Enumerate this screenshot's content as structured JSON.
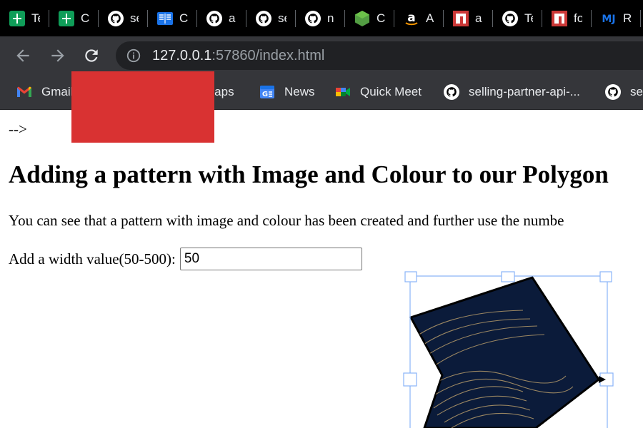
{
  "browser": {
    "tabs": [
      {
        "icon": "google-sheets-icon",
        "label": "Te",
        "color": "#0f9d58"
      },
      {
        "icon": "google-sheets-icon",
        "label": "C",
        "color": "#0f9d58"
      },
      {
        "icon": "github-icon",
        "label": "se"
      },
      {
        "icon": "book-icon",
        "label": "C",
        "color": "#1a73e8"
      },
      {
        "icon": "github-icon",
        "label": "a"
      },
      {
        "icon": "github-icon",
        "label": "se"
      },
      {
        "icon": "github-icon",
        "label": "n"
      },
      {
        "icon": "nodejs-icon",
        "label": "C",
        "color": "#539e43"
      },
      {
        "icon": "amazon-icon",
        "label": "A"
      },
      {
        "icon": "npm-icon",
        "label": "a",
        "color": "#cb3837"
      },
      {
        "icon": "github-icon",
        "label": "Te"
      },
      {
        "icon": "npm-icon",
        "label": "fo",
        "color": "#cb3837"
      },
      {
        "icon": "mj-icon",
        "label": "R",
        "color": "#1a73e8"
      }
    ],
    "url_host": "127.0.0.1",
    "url_rest": ":57860/index.html",
    "bookmarks": [
      {
        "icon": "gmail-icon",
        "label": "Gmail"
      },
      {
        "icon": "maps-icon",
        "label": "Maps"
      },
      {
        "icon": "google-news-icon",
        "label": "News"
      },
      {
        "icon": "google-meet-icon",
        "label": "Quick Meet"
      },
      {
        "icon": "github-icon",
        "label": "selling-partner-api-..."
      },
      {
        "icon": "github-icon",
        "label": "se"
      }
    ]
  },
  "page": {
    "stray_text": "-->",
    "heading": "Adding a pattern with Image and Colour to our Polygon",
    "paragraph": "You can see that a pattern with image and colour has been created and further use the numbe",
    "width_label": "Add a width value(50-500):",
    "width_value": "50"
  },
  "colors": {
    "tab_strip": "#000000",
    "toolbar": "#35363a",
    "omnibox": "#202124",
    "redaction": "#d93232",
    "star_fill": "#0b1b3a",
    "pattern_line": "#b59a6a",
    "handle": "#8ab4f8"
  }
}
